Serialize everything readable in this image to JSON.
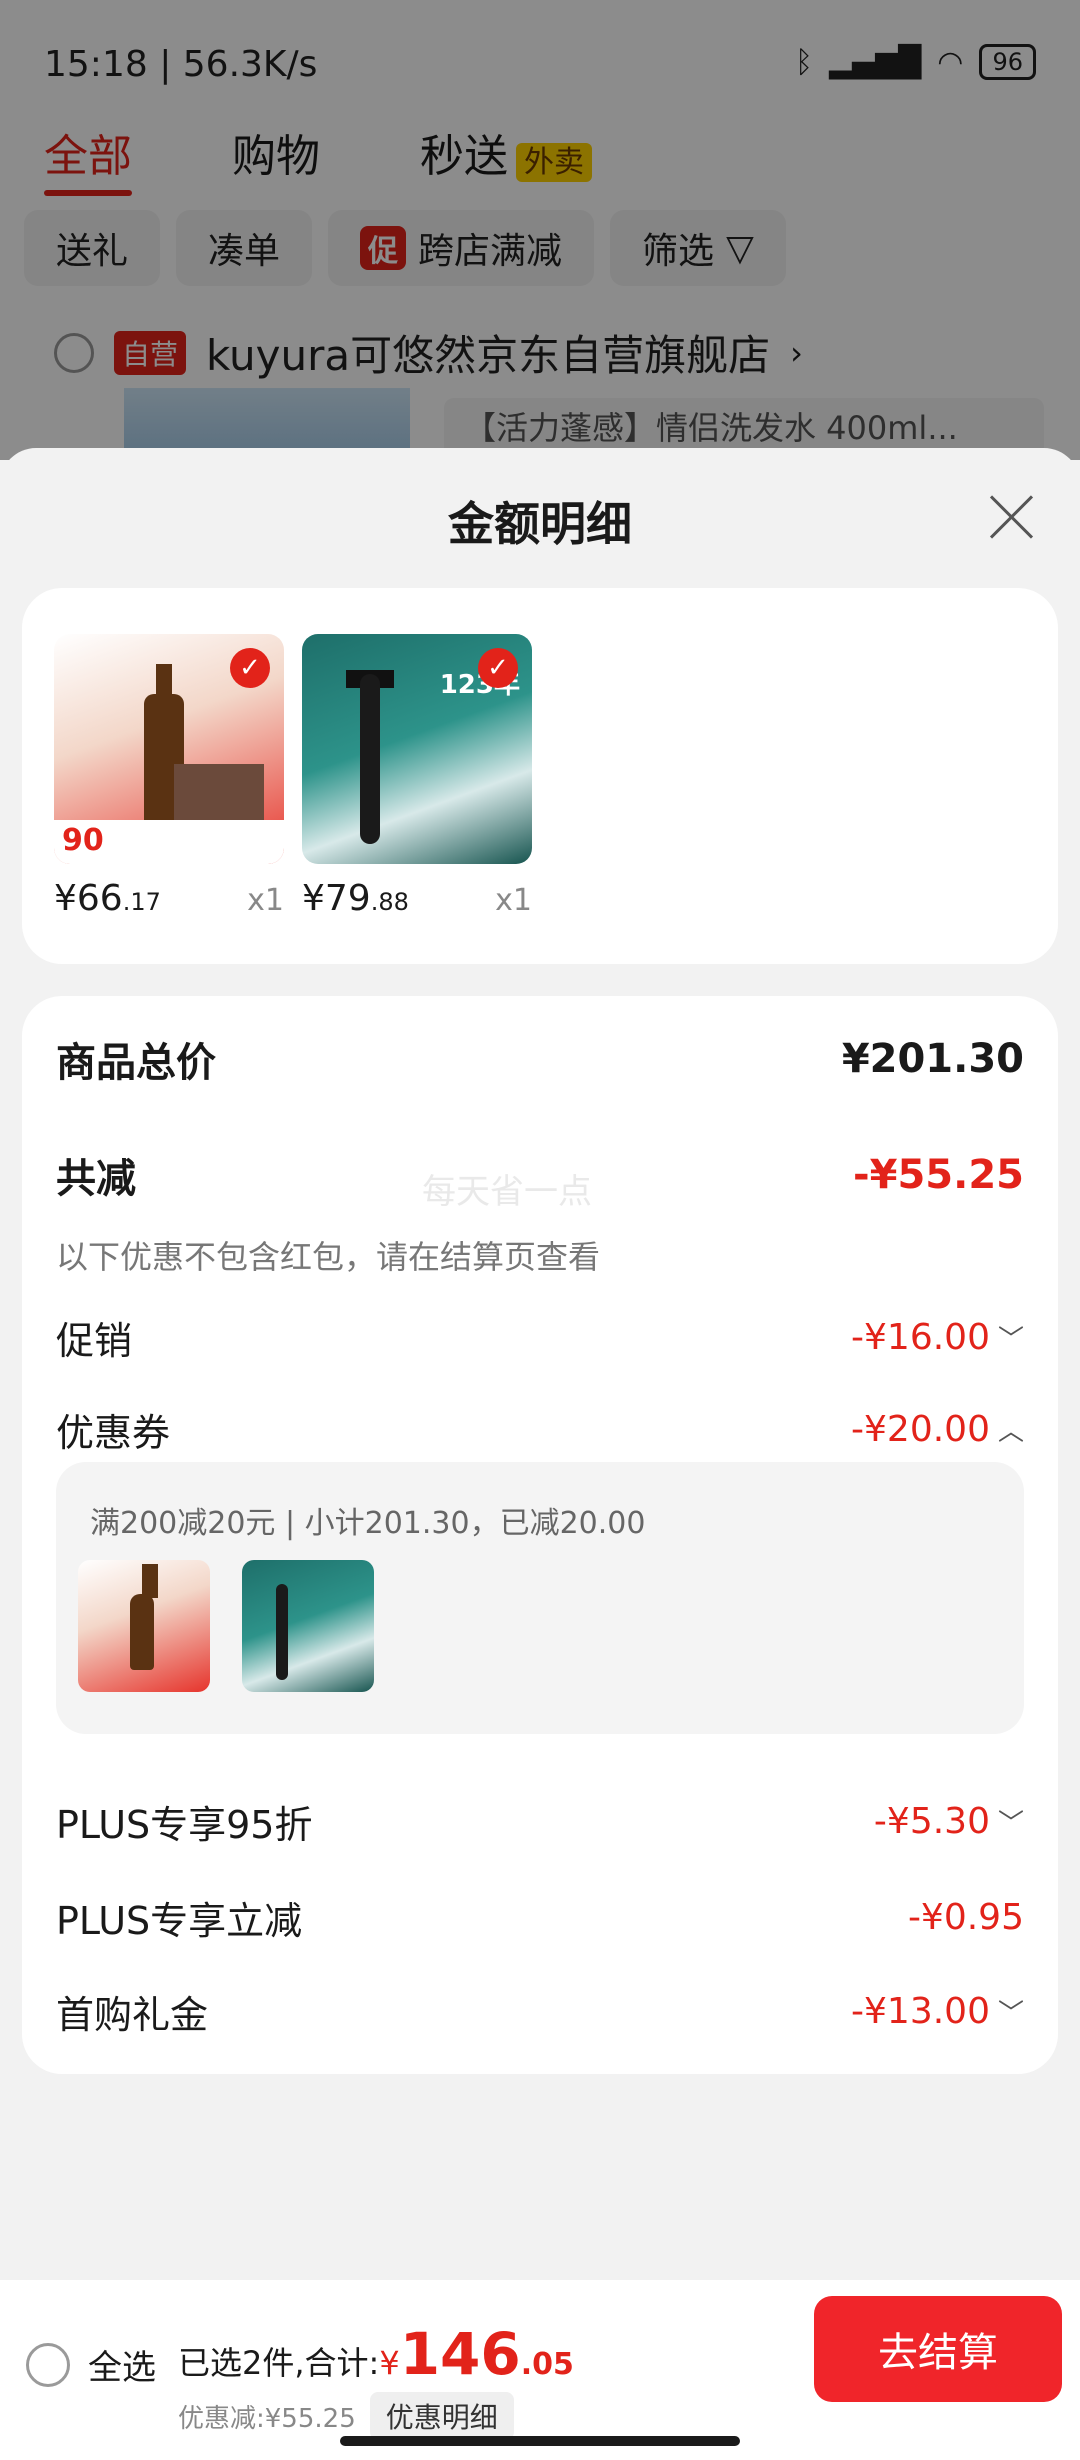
{
  "status_bar": {
    "time": "15:18",
    "speed": "56.3K/s",
    "battery": "96"
  },
  "background": {
    "tabs": [
      "全部",
      "购物",
      "秒送"
    ],
    "waimai_tag": "外卖",
    "chips": [
      "送礼",
      "凑单",
      "跨店满减",
      "筛选"
    ],
    "promo_badge": "促",
    "self_tag": "自营",
    "store_name": "kuyura可悠然京东自营旗舰店",
    "product_title": "【活力蓬感】情侣洗发水 400ml..."
  },
  "sheet": {
    "title": "金额明细",
    "products": [
      {
        "price_int": "66",
        "price_dec": ".17",
        "qty": "x1",
        "badge": "90"
      },
      {
        "price_int": "79",
        "price_dec": ".88",
        "qty": "x1",
        "badge": "123年"
      }
    ],
    "detail": {
      "total_label": "商品总价",
      "total_value": "¥201.30",
      "reduce_label": "共减",
      "reduce_value": "-¥55.25",
      "watermark": "每天省一点",
      "note": "以下优惠不包含红包，请在结算页查看",
      "items": [
        {
          "label": "促销",
          "value": "-¥16.00",
          "chevron": "down"
        },
        {
          "label": "优惠券",
          "value": "-¥20.00",
          "chevron": "up"
        },
        {
          "label": "PLUS专享95折",
          "value": "-¥5.30",
          "chevron": "down"
        },
        {
          "label": "PLUS专享立减",
          "value": "-¥0.95",
          "chevron": ""
        },
        {
          "label": "首购礼金",
          "value": "-¥13.00",
          "chevron": "down"
        }
      ],
      "coupon_text": "满200减20元 | 小计201.30，已减20.00"
    }
  },
  "bottom": {
    "select_all": "全选",
    "summary_prefix": "已选2件,合计:",
    "yen": "¥",
    "amount": "146",
    "cents": ".05",
    "discount_text": "优惠减:¥55.25",
    "detail_button": "优惠明细",
    "checkout": "去结算"
  },
  "colors": {
    "accent": "#e2231a",
    "checkout": "#f0252a"
  }
}
